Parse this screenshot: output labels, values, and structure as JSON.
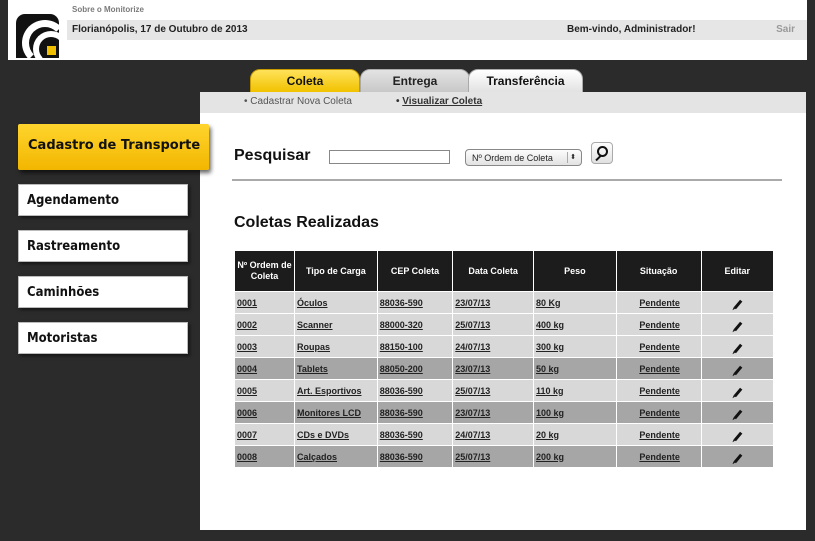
{
  "header": {
    "about": "Sobre o Monitorize",
    "date": "Florianópolis, 17 de Outubro de 2013",
    "welcome": "Bem-vindo, Administrador!",
    "logout": "Sair"
  },
  "tabs": [
    {
      "label": "Coleta",
      "active": true
    },
    {
      "label": "Entrega",
      "active": false
    },
    {
      "label": "Transferência",
      "active": false
    }
  ],
  "subnav": {
    "register": "Cadastrar Nova Coleta",
    "view": "Visualizar Coleta"
  },
  "sidebar": {
    "items": [
      {
        "label": "Cadastro de Transporte",
        "active": true
      },
      {
        "label": "Agendamento"
      },
      {
        "label": "Rastreamento"
      },
      {
        "label": "Caminhões"
      },
      {
        "label": "Motoristas"
      }
    ]
  },
  "search": {
    "label": "Pesquisar",
    "input_value": "",
    "filter_selected": "Nº Ordem de Coleta"
  },
  "section_title": "Coletas Realizadas",
  "table": {
    "headers": [
      "Nº Ordem de Coleta",
      "Tipo de Carga",
      "CEP Coleta",
      "Data Coleta",
      "Peso",
      "Situação",
      "Editar"
    ],
    "rows": [
      [
        "0001",
        "Óculos",
        "88036-590",
        "23/07/13",
        "80 Kg",
        "Pendente"
      ],
      [
        "0002",
        "Scanner",
        "88000-320",
        "25/07/13",
        "400 kg",
        "Pendente"
      ],
      [
        "0003",
        "Roupas",
        "88150-100",
        "24/07/13",
        "300 kg",
        "Pendente"
      ],
      [
        "0004",
        "Tablets",
        "88050-200",
        "23/07/13",
        "50 kg",
        "Pendente"
      ],
      [
        "0005",
        "Art. Esportivos",
        "88036-590",
        "25/07/13",
        "110 kg",
        "Pendente"
      ],
      [
        "0006",
        "Monitores LCD",
        "88036-590",
        "23/07/13",
        "100 kg",
        "Pendente"
      ],
      [
        "0007",
        "CDs e DVDs",
        "88036-590",
        "24/07/13",
        "20 kg",
        "Pendente"
      ],
      [
        "0008",
        "Calçados",
        "88036-590",
        "25/07/13",
        "200 kg",
        "Pendente"
      ]
    ]
  },
  "colors": {
    "accent": "#f2c200",
    "background": "#2b2b2b",
    "table_header": "#1c1c1c",
    "row_light": "#d8d8d8",
    "row_dark": "#a6a6a6"
  }
}
